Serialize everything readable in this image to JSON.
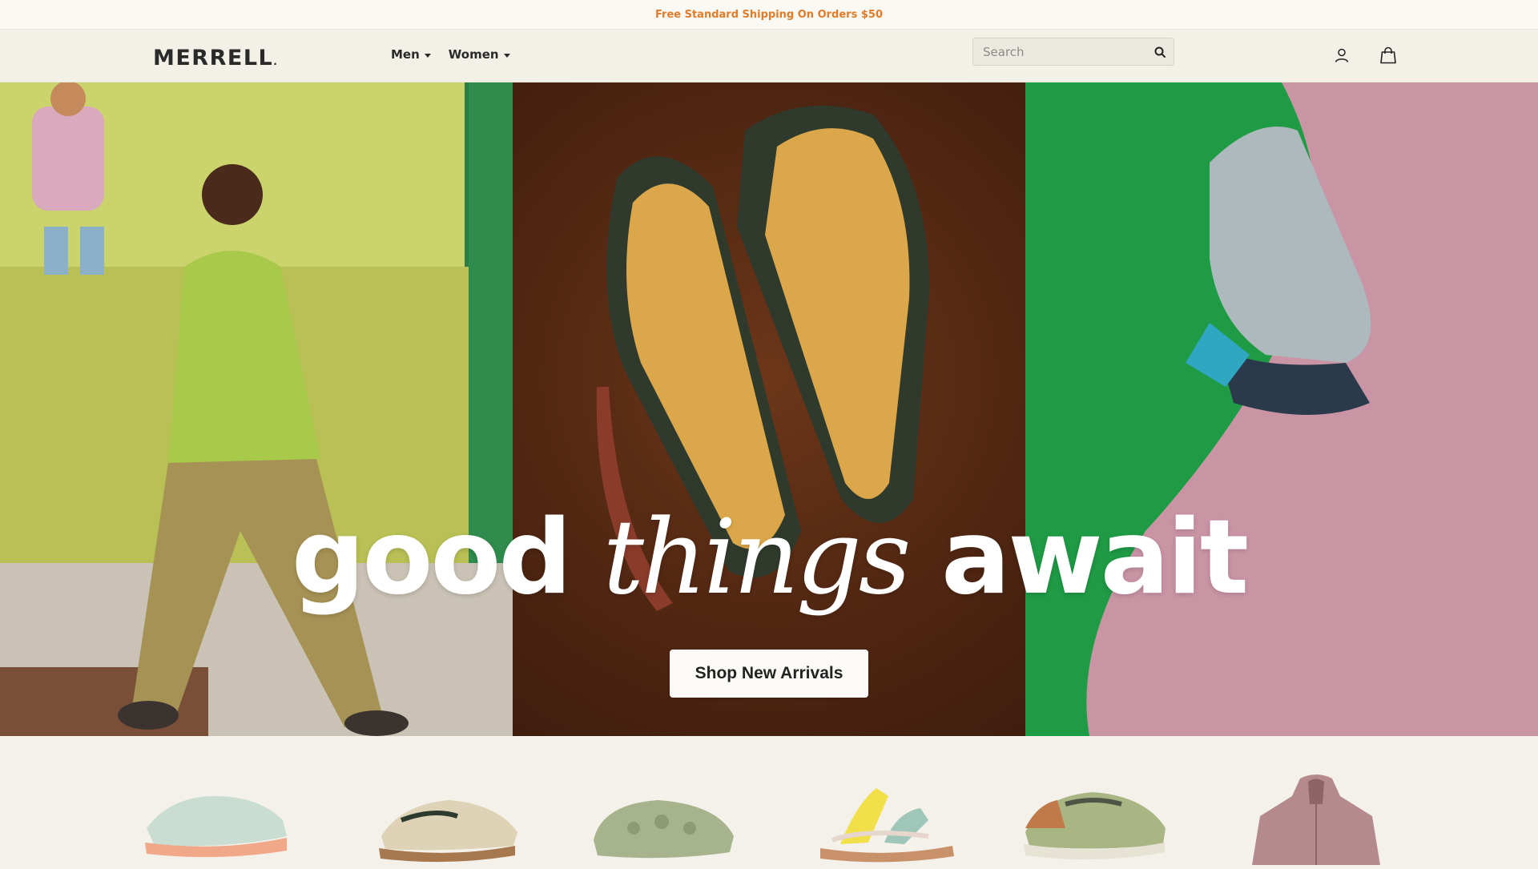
{
  "promo_bar": {
    "text": "Free Standard Shipping On Orders $50"
  },
  "header": {
    "logo": "MERRELL",
    "nav": [
      {
        "label": "Men"
      },
      {
        "label": "Women"
      }
    ],
    "search": {
      "placeholder": "Search"
    },
    "icons": [
      "account-icon",
      "shopping-bag-icon"
    ]
  },
  "hero": {
    "headline_part1": "good",
    "headline_part2": "things",
    "headline_part3": "await",
    "cta_label": "Shop New Arrivals"
  },
  "colors": {
    "promo_text": "#e07b2a",
    "header_bg": "#f3f0e8",
    "page_bg": "#f4f1ea"
  }
}
